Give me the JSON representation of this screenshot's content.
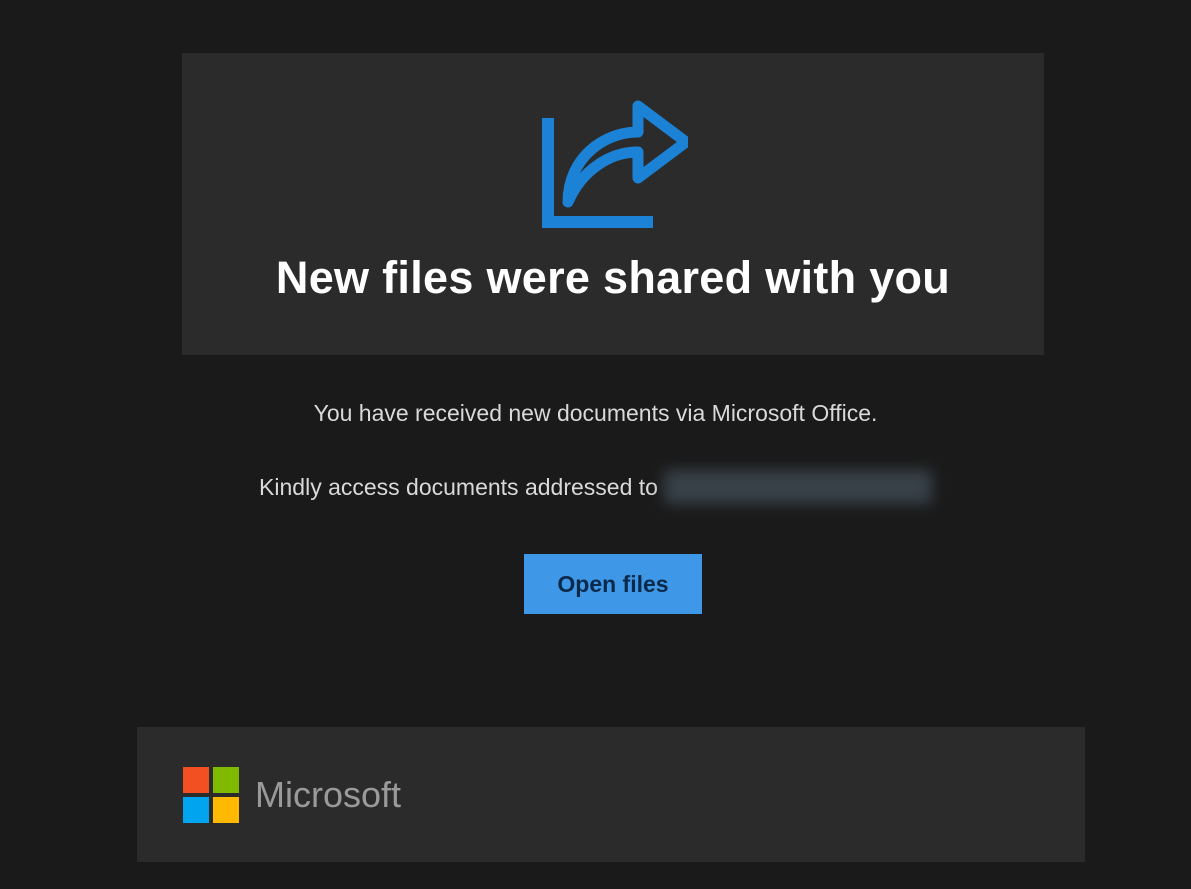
{
  "hero": {
    "title": "New files were shared with you"
  },
  "body": {
    "line1": "You have received new documents via Microsoft Office.",
    "line2_prefix": "Kindly access documents addressed to"
  },
  "button": {
    "open_label": "Open files"
  },
  "footer": {
    "brand": "Microsoft"
  },
  "colors": {
    "accent": "#3f97e8",
    "ms_red": "#f25022",
    "ms_green": "#7fba00",
    "ms_blue": "#00a4ef",
    "ms_yellow": "#ffb900"
  }
}
